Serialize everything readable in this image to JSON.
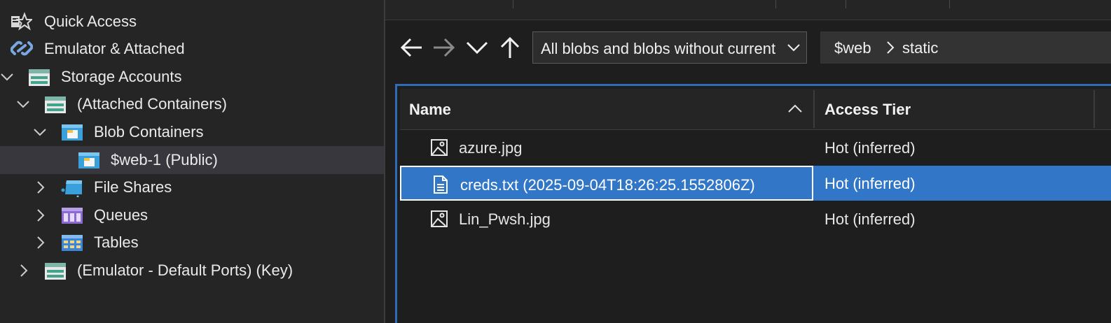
{
  "tree": {
    "items": [
      {
        "label": "Quick Access",
        "icon": "quick-access-icon"
      },
      {
        "label": "Emulator & Attached",
        "icon": "link-icon"
      },
      {
        "label": "Storage Accounts",
        "icon": "storage-account-icon",
        "expanded": true
      },
      {
        "label": "(Attached Containers)",
        "icon": "storage-account-icon",
        "expanded": true
      },
      {
        "label": "Blob Containers",
        "icon": "blob-containers-icon",
        "expanded": true
      },
      {
        "label": "$web-1 (Public)",
        "icon": "blob-container-icon",
        "selected": true
      },
      {
        "label": "File Shares",
        "icon": "file-shares-icon",
        "expanded": false
      },
      {
        "label": "Queues",
        "icon": "queues-icon",
        "expanded": false
      },
      {
        "label": "Tables",
        "icon": "tables-icon",
        "expanded": false
      },
      {
        "label": "(Emulator - Default Ports) (Key)",
        "icon": "storage-account-icon",
        "expanded": false
      }
    ]
  },
  "toolbar": {
    "back_icon": "arrow-left-icon",
    "forward_icon": "arrow-right-icon",
    "dropdown_icon": "chevron-down-icon",
    "up_icon": "arrow-up-icon",
    "filter_value": "All blobs and blobs without current version",
    "breadcrumb": [
      "$web",
      "static"
    ]
  },
  "grid": {
    "columns": [
      "Name",
      "Access Tier"
    ],
    "rows": [
      {
        "name": "azure.jpg",
        "tier": "Hot (inferred)",
        "icon": "image-file-icon",
        "selected": false
      },
      {
        "name": "creds.txt (2025-09-04T18:26:25.1552806Z)",
        "tier": "Hot (inferred)",
        "icon": "text-file-icon",
        "selected": true
      },
      {
        "name": "Lin_Pwsh.jpg",
        "tier": "Hot (inferred)",
        "icon": "image-file-icon",
        "selected": false
      }
    ]
  },
  "colors": {
    "background": "#1e1e1e",
    "panel": "#252526",
    "selection": "#3276c8",
    "focus_border": "#2f6cb8",
    "tree_selection": "#37373d"
  }
}
